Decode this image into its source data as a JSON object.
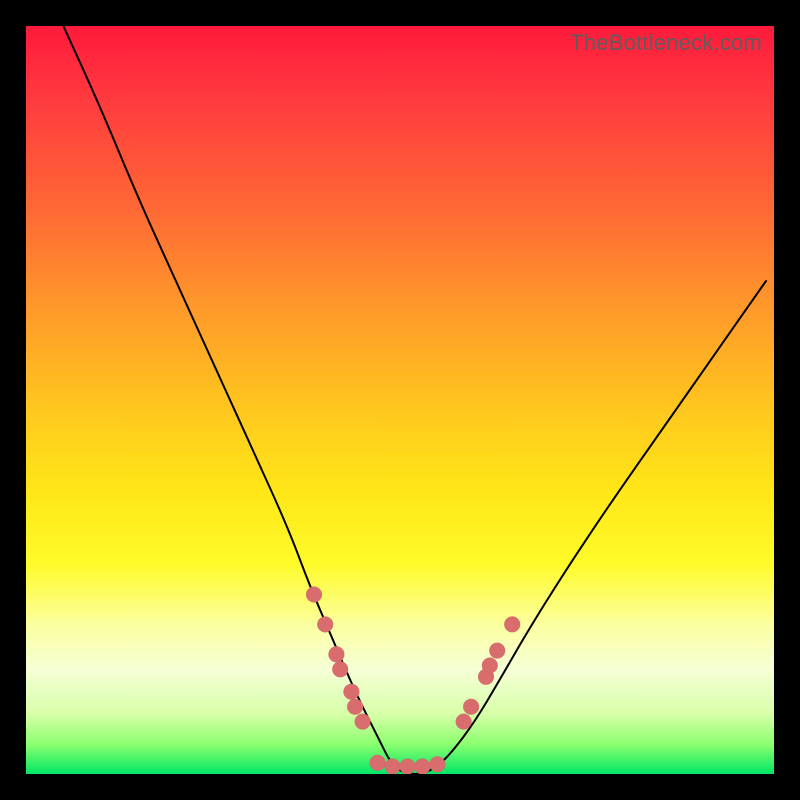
{
  "watermark": "TheBottleneck.com",
  "colors": {
    "background_frame": "#000000",
    "gradient_top": "#ff1a3c",
    "gradient_mid": "#ffe617",
    "gradient_bottom": "#00e765",
    "curve": "#000000",
    "markers": "#d96d6d"
  },
  "chart_data": {
    "type": "line",
    "title": "",
    "xlabel": "",
    "ylabel": "",
    "xlim": [
      0,
      100
    ],
    "ylim": [
      0,
      100
    ],
    "note": "Axes are unlabeled in the source image; x/y are normalized 0–100 based on plot-area position (y = 100 at top). Curve is a V/U-shaped dip reaching ~0 near x≈50 and rising towards both edges. Markers are pink dots clustered on the lower flanks and floor of the dip.",
    "series": [
      {
        "name": "curve",
        "x": [
          5,
          10,
          15,
          20,
          25,
          30,
          35,
          38,
          41,
          44,
          47,
          49,
          51,
          53,
          55,
          57,
          60,
          63,
          67,
          72,
          78,
          85,
          92,
          99
        ],
        "y": [
          100,
          89,
          77,
          66,
          55,
          44,
          33,
          25,
          18,
          11,
          5,
          1,
          0,
          0,
          1,
          3,
          7,
          12,
          19,
          27,
          36,
          46,
          56,
          66
        ]
      }
    ],
    "markers": [
      {
        "x": 38.5,
        "y": 24
      },
      {
        "x": 40.0,
        "y": 20
      },
      {
        "x": 41.5,
        "y": 16
      },
      {
        "x": 42.0,
        "y": 14
      },
      {
        "x": 43.5,
        "y": 11
      },
      {
        "x": 44.0,
        "y": 9
      },
      {
        "x": 45.0,
        "y": 7
      },
      {
        "x": 47.0,
        "y": 1.5
      },
      {
        "x": 49.0,
        "y": 1
      },
      {
        "x": 51.0,
        "y": 1
      },
      {
        "x": 53.0,
        "y": 1
      },
      {
        "x": 55.0,
        "y": 1.3
      },
      {
        "x": 58.5,
        "y": 7
      },
      {
        "x": 59.5,
        "y": 9
      },
      {
        "x": 61.5,
        "y": 13
      },
      {
        "x": 62.0,
        "y": 14.5
      },
      {
        "x": 63.0,
        "y": 16.5
      },
      {
        "x": 65.0,
        "y": 20
      }
    ]
  }
}
